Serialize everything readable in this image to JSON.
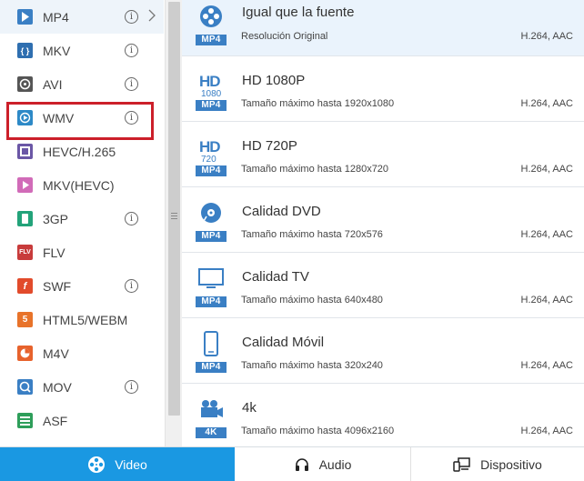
{
  "formats": [
    {
      "label": "MP4",
      "icon": "mp4-icon",
      "color": "#3a7fc4",
      "info": true,
      "chevron": true,
      "active": true
    },
    {
      "label": "MKV",
      "icon": "mkv-icon",
      "color": "#2f6fb0",
      "info": true
    },
    {
      "label": "AVI",
      "icon": "avi-icon",
      "color": "#555555",
      "info": true
    },
    {
      "label": "WMV",
      "icon": "wmv-icon",
      "color": "#2d89c7",
      "info": true,
      "highlighted": true
    },
    {
      "label": "HEVC/H.265",
      "icon": "hevc-icon",
      "color": "#6b57a6",
      "info": false
    },
    {
      "label": "MKV(HEVC)",
      "icon": "mkv-hevc-icon",
      "color": "#d16bb8",
      "info": false
    },
    {
      "label": "3GP",
      "icon": "3gp-icon",
      "color": "#23a37a",
      "info": true
    },
    {
      "label": "FLV",
      "icon": "flv-icon",
      "color": "#c83b3b",
      "info": false
    },
    {
      "label": "SWF",
      "icon": "swf-icon",
      "color": "#e24b2b",
      "info": true
    },
    {
      "label": "HTML5/WEBM",
      "icon": "html5-icon",
      "color": "#e8732a",
      "info": false
    },
    {
      "label": "M4V",
      "icon": "m4v-icon",
      "color": "#e7622c",
      "info": false
    },
    {
      "label": "MOV",
      "icon": "mov-icon",
      "color": "#3a7fc4",
      "info": true
    },
    {
      "label": "ASF",
      "icon": "asf-icon",
      "color": "#2e9e5a",
      "info": false
    }
  ],
  "info_glyph": "i",
  "presets": [
    {
      "title": "Igual que la fuente",
      "subtitle": "Resolución Original",
      "codec": "H.264, AAC",
      "badge": "MP4",
      "icon": "reel-icon",
      "selected": true
    },
    {
      "title": "HD 1080P",
      "subtitle": "Tamaño máximo hasta 1920x1080",
      "codec": "H.264, AAC",
      "badge": "MP4",
      "icon": "hd-1080-icon",
      "hd_text": "HD",
      "hd_res": "1080"
    },
    {
      "title": "HD 720P",
      "subtitle": "Tamaño máximo hasta 1280x720",
      "codec": "H.264, AAC",
      "badge": "MP4",
      "icon": "hd-720-icon",
      "hd_text": "HD",
      "hd_res": "720"
    },
    {
      "title": "Calidad DVD",
      "subtitle": "Tamaño máximo hasta 720x576",
      "codec": "H.264, AAC",
      "badge": "MP4",
      "icon": "dvd-icon"
    },
    {
      "title": "Calidad TV",
      "subtitle": "Tamaño máximo hasta 640x480",
      "codec": "H.264, AAC",
      "badge": "MP4",
      "icon": "tv-icon"
    },
    {
      "title": "Calidad Móvil",
      "subtitle": "Tamaño máximo hasta 320x240",
      "codec": "H.264, AAC",
      "badge": "MP4",
      "icon": "phone-icon"
    },
    {
      "title": "4k",
      "subtitle": "Tamaño máximo hasta 4096x2160",
      "codec": "H.264, AAC",
      "badge": "4K",
      "icon": "camera-icon"
    }
  ],
  "tabs": {
    "video": "Video",
    "audio": "Audio",
    "device": "Dispositivo"
  },
  "colors": {
    "accent": "#1a98e2",
    "badge": "#3a7fc4",
    "highlight_box": "#cc1f2a"
  }
}
